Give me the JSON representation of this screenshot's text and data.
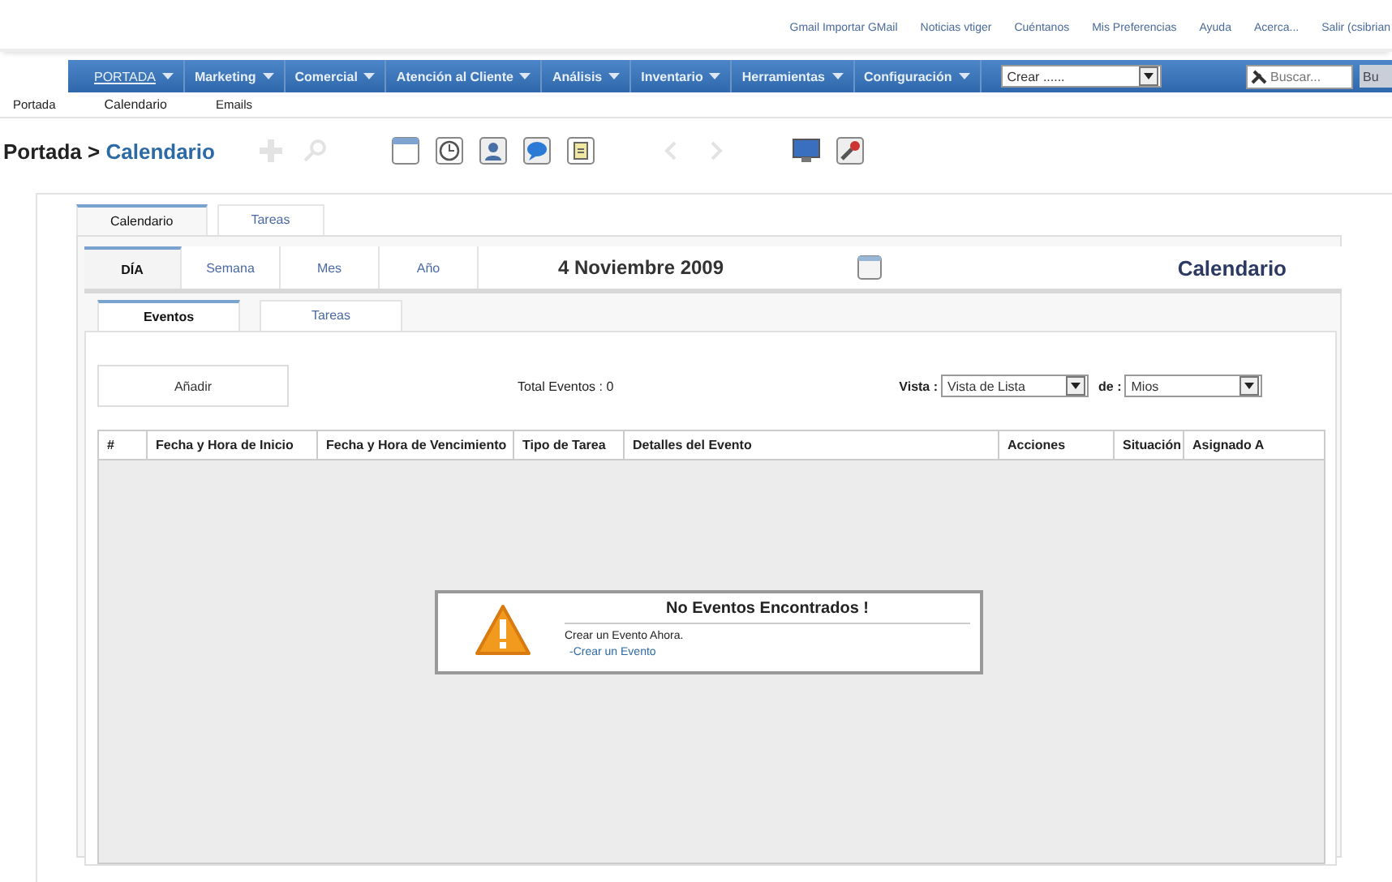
{
  "top_links": [
    "Gmail Importar GMail",
    "Noticias vtiger",
    "Cuéntanos",
    "Mis Preferencias",
    "Ayuda",
    "Acerca...",
    "Salir (csibrian"
  ],
  "nav": [
    {
      "label": "PORTADA",
      "selected": true
    },
    {
      "label": "Marketing",
      "selected": false
    },
    {
      "label": "Comercial",
      "selected": false
    },
    {
      "label": "Atención al Cliente",
      "selected": false
    },
    {
      "label": "Análisis",
      "selected": false
    },
    {
      "label": "Inventario",
      "selected": false
    },
    {
      "label": "Herramientas",
      "selected": false
    },
    {
      "label": "Configuración",
      "selected": false
    }
  ],
  "create_select": {
    "value": "Crear ......"
  },
  "search": {
    "placeholder": "Buscar...",
    "button": "Bu"
  },
  "subnav": [
    "Portada",
    "Calendario",
    "Emails"
  ],
  "breadcrumb": {
    "parent": "Portada >",
    "current": "Calendario"
  },
  "toolbar": [
    {
      "kind": "add",
      "disabled": true
    },
    {
      "kind": "search",
      "disabled": true
    },
    {
      "kind": "calendar",
      "disabled": false
    },
    {
      "kind": "clock",
      "disabled": false
    },
    {
      "kind": "contact",
      "disabled": false
    },
    {
      "kind": "chat",
      "disabled": false
    },
    {
      "kind": "notes",
      "disabled": false
    },
    {
      "kind": "prev",
      "disabled": true
    },
    {
      "kind": "next",
      "disabled": true
    },
    {
      "kind": "import",
      "disabled": false
    },
    {
      "kind": "tools",
      "disabled": false
    }
  ],
  "module_tabs": [
    {
      "label": "Calendario",
      "selected": true
    },
    {
      "label": "Tareas",
      "selected": false
    }
  ],
  "view_tabs": [
    {
      "label": "DÍA",
      "selected": true
    },
    {
      "label": "Semana",
      "selected": false
    },
    {
      "label": "Mes",
      "selected": false
    },
    {
      "label": "Año",
      "selected": false
    }
  ],
  "date": "4 Noviembre 2009",
  "calendar_title": "Calendario",
  "list_tabs": [
    {
      "label": "Eventos",
      "selected": true
    },
    {
      "label": "Tareas",
      "selected": false
    }
  ],
  "add_button": "Añadir",
  "total": "Total Eventos : 0",
  "view_label": "Vista :",
  "view_value": "Vista de Lista",
  "of_label": "de :",
  "of_value": "Mios",
  "table": {
    "columns": [
      "#",
      "Fecha y Hora de Inicio",
      "Fecha y Hora de Vencimiento",
      "Tipo de Tarea",
      "Detalles del Evento",
      "Acciones",
      "Situación",
      "Asignado A"
    ]
  },
  "empty": {
    "title": "No Eventos Encontrados !",
    "text": "Crear un Evento Ahora.",
    "link": "-Crear un Evento"
  }
}
